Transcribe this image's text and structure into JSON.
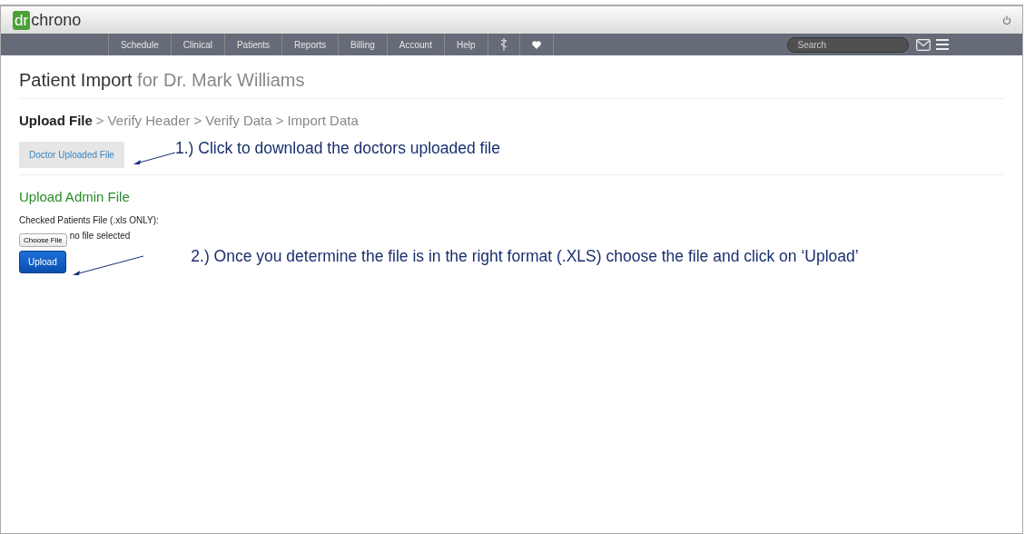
{
  "logo": {
    "mark": "dr",
    "name": "chrono"
  },
  "nav": {
    "items": [
      {
        "kind": "text",
        "label": "Schedule"
      },
      {
        "kind": "text",
        "label": "Clinical"
      },
      {
        "kind": "text",
        "label": "Patients"
      },
      {
        "kind": "text",
        "label": "Reports"
      },
      {
        "kind": "text",
        "label": "Billing"
      },
      {
        "kind": "text",
        "label": "Account"
      },
      {
        "kind": "text",
        "label": "Help"
      },
      {
        "kind": "staff"
      },
      {
        "kind": "heart"
      }
    ],
    "search": {
      "placeholder": "Search"
    }
  },
  "page": {
    "title": "Patient Import",
    "subtitle": "for Dr. Mark Williams"
  },
  "breadcrumb": [
    {
      "label": "Upload File",
      "selected": true
    },
    {
      "prefix": ">",
      "label": "Verify Header",
      "selected": false
    },
    {
      "prefix": ">",
      "label": "Verify Data",
      "selected": false
    },
    {
      "prefix": ">",
      "label": "Import Data",
      "selected": false
    }
  ],
  "download_button": "Doctor Uploaded File",
  "upload_section": {
    "heading": "Upload Admin File",
    "field_label": "Checked Patients File (.xls ONLY):",
    "choose_button": "Choose File",
    "file_status": "no file selected",
    "upload_button": "Upload"
  },
  "annotations": [
    "1.) Click to download the doctors uploaded file",
    "2.) Once you determine the file is in the right format (.XLS) choose the file and click on ‘Upload’"
  ]
}
